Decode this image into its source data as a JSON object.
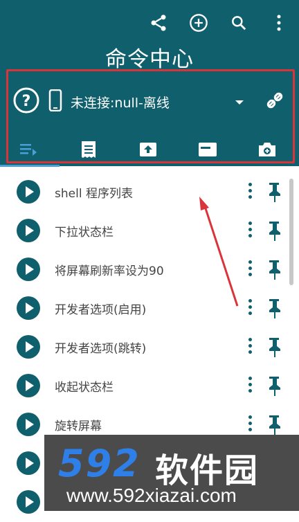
{
  "header": {
    "title": "命令中心",
    "actions": [
      "share-icon",
      "add-circle-icon",
      "search-icon",
      "more-vert-icon"
    ]
  },
  "status": {
    "help_icon": "help-icon",
    "device_icon": "phone-icon",
    "text": "未连接:null-离线",
    "dropdown_icon": "dropdown-arrow-icon",
    "link_icon": "link-icon"
  },
  "tabs": [
    {
      "icon": "playlist-icon",
      "selected": true
    },
    {
      "icon": "receipt-icon",
      "selected": false
    },
    {
      "icon": "upload-box-icon",
      "selected": false
    },
    {
      "icon": "card-icon",
      "selected": false
    },
    {
      "icon": "camera-icon",
      "selected": false
    }
  ],
  "list": {
    "items": [
      {
        "label": "shell 程序列表"
      },
      {
        "label": "下拉状态栏"
      },
      {
        "label": "将屏幕刷新率设为90"
      },
      {
        "label": "开发者选项(启用)"
      },
      {
        "label": "开发者选项(跳转)"
      },
      {
        "label": "收起状态栏"
      },
      {
        "label": "旋转屏幕"
      },
      {
        "label": ""
      },
      {
        "label": ""
      }
    ]
  },
  "watermark": {
    "number": "592",
    "brand": "软件园",
    "url": "www.592xiazai.com"
  },
  "colors": {
    "primary": "#0f5f6d",
    "highlight_box": "#d8343a",
    "arrow": "#d8343a",
    "tab_indicator": "#4a9fd8"
  }
}
